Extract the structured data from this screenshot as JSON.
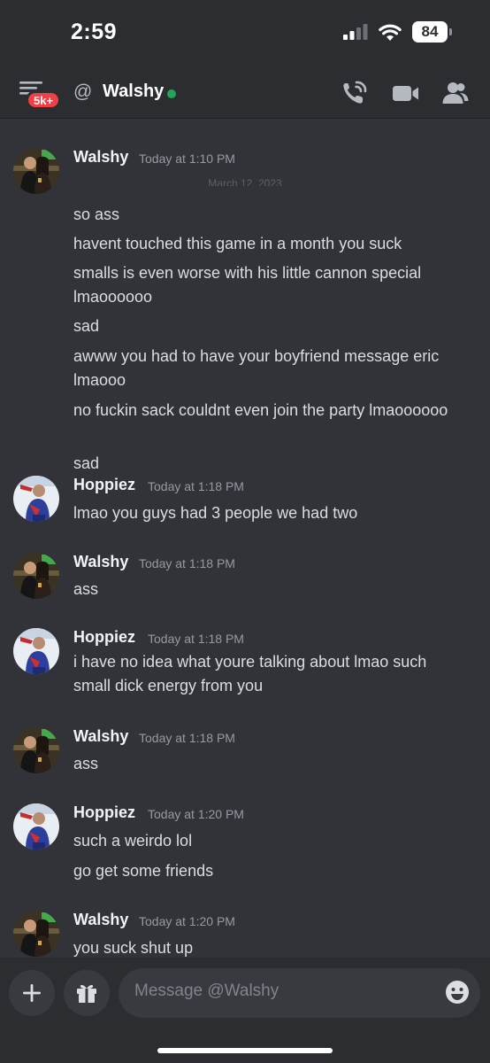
{
  "status_bar": {
    "time": "2:59",
    "battery": "84"
  },
  "header": {
    "unread_badge": "5k+",
    "at_symbol": "@",
    "dm_name": "Walshy",
    "date_divider": "March 12, 2023",
    "online_color": "#23a55a"
  },
  "messages": [
    {
      "author": "Walshy",
      "timestamp": "Today at 1:10 PM",
      "lines": [
        "so ass",
        "havent touched this game in a month you suck",
        "smalls is even worse with his little cannon special lmaoooooo",
        "sad",
        "awww you had to have your boyfriend message eric lmaooo",
        "no fuckin sack couldnt even join the party lmaoooooo",
        "sad"
      ]
    },
    {
      "author": "Hoppiez",
      "timestamp": "Today at 1:18 PM",
      "lines": [
        "lmao you guys had 3 people we had two"
      ]
    },
    {
      "author": "Walshy",
      "timestamp": "Today at 1:18 PM",
      "lines": [
        "ass"
      ]
    },
    {
      "author": "Hoppiez",
      "timestamp": "Today at 1:18 PM",
      "lines": [
        "i have no idea what youre talking about lmao such small dick energy from you"
      ]
    },
    {
      "author": "Walshy",
      "timestamp": "Today at 1:18 PM",
      "lines": [
        "ass"
      ]
    },
    {
      "author": "Hoppiez",
      "timestamp": "Today at 1:20 PM",
      "lines": [
        "such a weirdo lol",
        "go get some friends"
      ]
    },
    {
      "author": "Walshy",
      "timestamp": "Today at 1:20 PM",
      "lines": [
        "you suck shut up"
      ]
    }
  ],
  "composer": {
    "placeholder": "Message @Walshy"
  },
  "icons": {
    "menu": "hamburger-menu-icon",
    "call": "voice-call-icon",
    "video": "video-call-icon",
    "members": "member-list-icon",
    "add": "plus-icon",
    "gift": "gift-icon",
    "emoji": "emoji-icon"
  },
  "colors": {
    "background": "#313338",
    "chrome": "#2b2d31",
    "badge": "#f23f43"
  }
}
